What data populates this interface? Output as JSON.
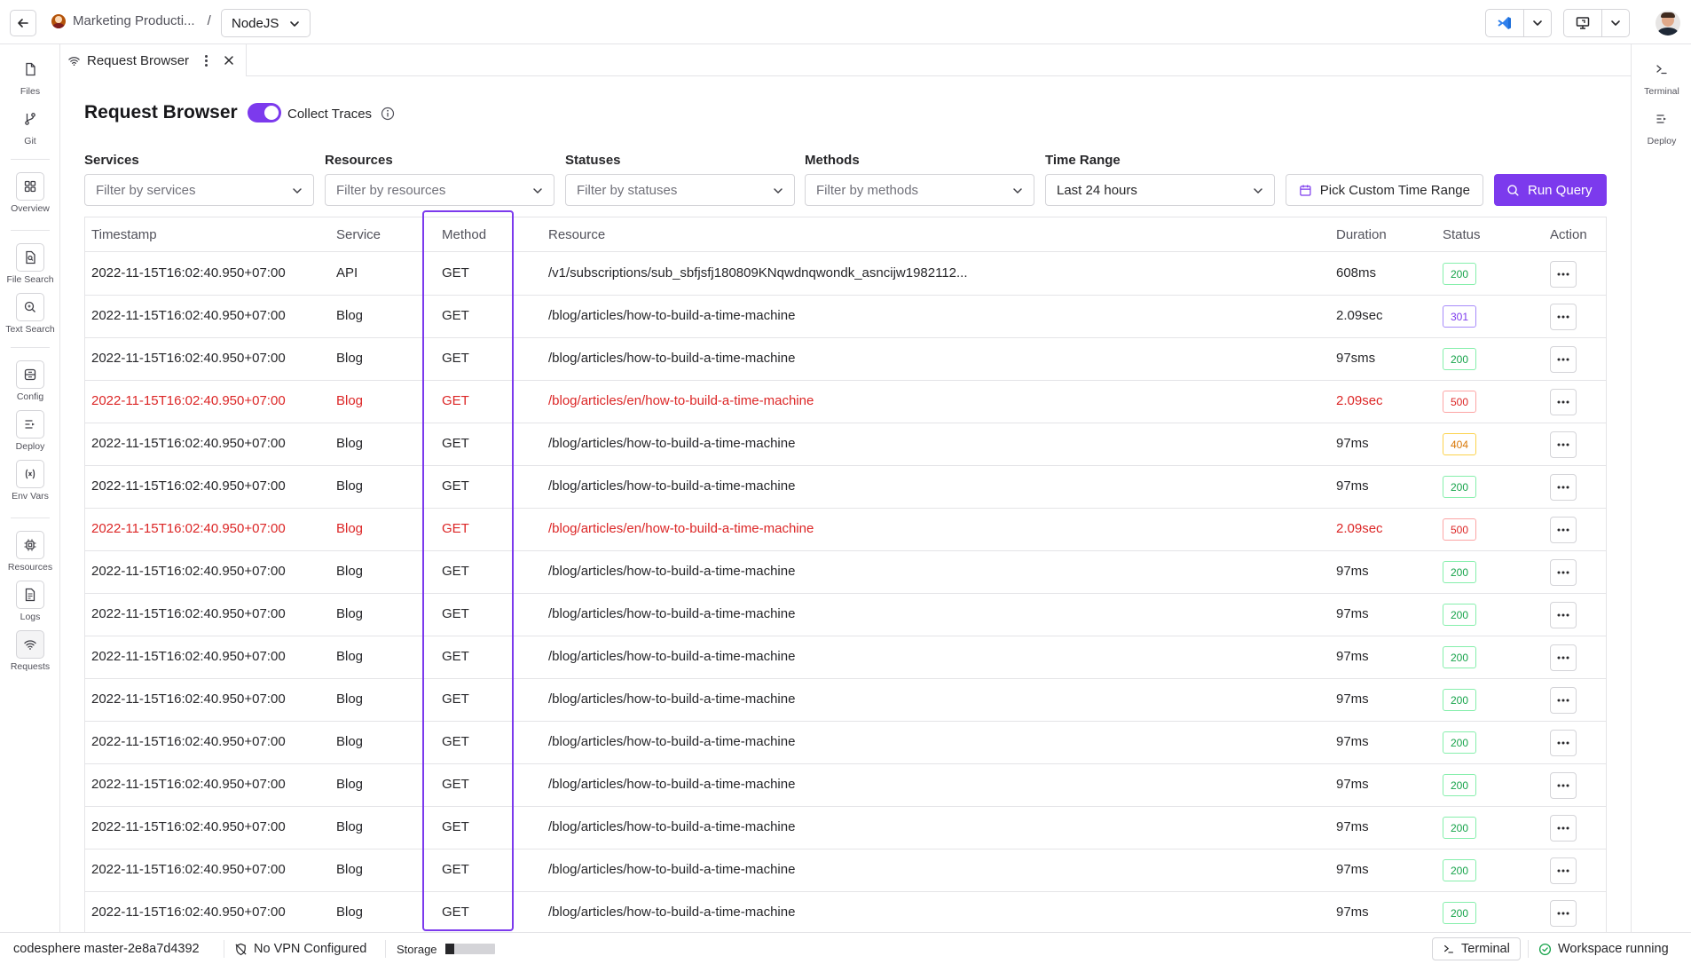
{
  "topbar": {
    "project_name": "Marketing Producti...",
    "separator": "/",
    "workspace_name": "NodeJS"
  },
  "left_rail": [
    {
      "label": "Files",
      "icon": "file-icon"
    },
    {
      "label": "Git",
      "icon": "git-branch-icon"
    },
    {
      "label": "Overview",
      "icon": "grid-icon"
    },
    {
      "label": "File Search",
      "icon": "file-search-icon"
    },
    {
      "label": "Text Search",
      "icon": "text-search-icon"
    },
    {
      "label": "Config",
      "icon": "config-icon"
    },
    {
      "label": "Deploy",
      "icon": "deploy-icon"
    },
    {
      "label": "Env Vars",
      "icon": "env-vars-icon"
    },
    {
      "label": "Resources",
      "icon": "chip-icon"
    },
    {
      "label": "Logs",
      "icon": "logs-icon"
    },
    {
      "label": "Requests",
      "icon": "wifi-icon"
    }
  ],
  "right_rail": [
    {
      "label": "Terminal",
      "icon": "terminal-icon"
    },
    {
      "label": "Deploy",
      "icon": "deploy-icon"
    }
  ],
  "tab": {
    "label": "Request Browser"
  },
  "header": {
    "title": "Request Browser",
    "toggle_label": "Collect Traces",
    "toggle_on": true
  },
  "filters": {
    "services": {
      "label": "Services",
      "placeholder": "Filter by services"
    },
    "resources": {
      "label": "Resources",
      "placeholder": "Filter by resources"
    },
    "statuses": {
      "label": "Statuses",
      "placeholder": "Filter by statuses"
    },
    "methods": {
      "label": "Methods",
      "placeholder": "Filter by methods"
    },
    "time_range": {
      "label": "Time Range",
      "value": "Last 24 hours"
    },
    "custom_range_button": "Pick Custom Time Range",
    "run_button": "Run Query"
  },
  "table": {
    "columns": [
      "Timestamp",
      "Service",
      "Method",
      "Resource",
      "Duration",
      "Status",
      "Action"
    ],
    "rows": [
      {
        "timestamp": "2022-11-15T16:02:40.950+07:00",
        "service": "API",
        "method": "GET",
        "resource": "/v1/subscriptions/sub_sbfjsfj180809KNqwdnqwondk_asncijw1982112...",
        "duration": "608ms",
        "status": "200",
        "error": false
      },
      {
        "timestamp": "2022-11-15T16:02:40.950+07:00",
        "service": "Blog",
        "method": "GET",
        "resource": "/blog/articles/how-to-build-a-time-machine",
        "duration": "2.09sec",
        "status": "301",
        "error": false
      },
      {
        "timestamp": "2022-11-15T16:02:40.950+07:00",
        "service": "Blog",
        "method": "GET",
        "resource": "/blog/articles/how-to-build-a-time-machine",
        "duration": "97sms",
        "status": "200",
        "error": false
      },
      {
        "timestamp": "2022-11-15T16:02:40.950+07:00",
        "service": "Blog",
        "method": "GET",
        "resource": "/blog/articles/en/how-to-build-a-time-machine",
        "duration": "2.09sec",
        "status": "500",
        "error": true
      },
      {
        "timestamp": "2022-11-15T16:02:40.950+07:00",
        "service": "Blog",
        "method": "GET",
        "resource": "/blog/articles/how-to-build-a-time-machine",
        "duration": "97ms",
        "status": "404",
        "error": false
      },
      {
        "timestamp": "2022-11-15T16:02:40.950+07:00",
        "service": "Blog",
        "method": "GET",
        "resource": "/blog/articles/how-to-build-a-time-machine",
        "duration": "97ms",
        "status": "200",
        "error": false
      },
      {
        "timestamp": "2022-11-15T16:02:40.950+07:00",
        "service": "Blog",
        "method": "GET",
        "resource": "/blog/articles/en/how-to-build-a-time-machine",
        "duration": "2.09sec",
        "status": "500",
        "error": true
      },
      {
        "timestamp": "2022-11-15T16:02:40.950+07:00",
        "service": "Blog",
        "method": "GET",
        "resource": "/blog/articles/how-to-build-a-time-machine",
        "duration": "97ms",
        "status": "200",
        "error": false
      },
      {
        "timestamp": "2022-11-15T16:02:40.950+07:00",
        "service": "Blog",
        "method": "GET",
        "resource": "/blog/articles/how-to-build-a-time-machine",
        "duration": "97ms",
        "status": "200",
        "error": false
      },
      {
        "timestamp": "2022-11-15T16:02:40.950+07:00",
        "service": "Blog",
        "method": "GET",
        "resource": "/blog/articles/how-to-build-a-time-machine",
        "duration": "97ms",
        "status": "200",
        "error": false
      },
      {
        "timestamp": "2022-11-15T16:02:40.950+07:00",
        "service": "Blog",
        "method": "GET",
        "resource": "/blog/articles/how-to-build-a-time-machine",
        "duration": "97ms",
        "status": "200",
        "error": false
      },
      {
        "timestamp": "2022-11-15T16:02:40.950+07:00",
        "service": "Blog",
        "method": "GET",
        "resource": "/blog/articles/how-to-build-a-time-machine",
        "duration": "97ms",
        "status": "200",
        "error": false
      },
      {
        "timestamp": "2022-11-15T16:02:40.950+07:00",
        "service": "Blog",
        "method": "GET",
        "resource": "/blog/articles/how-to-build-a-time-machine",
        "duration": "97ms",
        "status": "200",
        "error": false
      },
      {
        "timestamp": "2022-11-15T16:02:40.950+07:00",
        "service": "Blog",
        "method": "GET",
        "resource": "/blog/articles/how-to-build-a-time-machine",
        "duration": "97ms",
        "status": "200",
        "error": false
      },
      {
        "timestamp": "2022-11-15T16:02:40.950+07:00",
        "service": "Blog",
        "method": "GET",
        "resource": "/blog/articles/how-to-build-a-time-machine",
        "duration": "97ms",
        "status": "200",
        "error": false
      },
      {
        "timestamp": "2022-11-15T16:02:40.950+07:00",
        "service": "Blog",
        "method": "GET",
        "resource": "/blog/articles/how-to-build-a-time-machine",
        "duration": "97ms",
        "status": "200",
        "error": false
      }
    ]
  },
  "status_colors": {
    "200": {
      "fg": "#16a34a",
      "border": "#86efac"
    },
    "301": {
      "fg": "#7c3aed",
      "border": "#a78bfa"
    },
    "404": {
      "fg": "#d97706",
      "border": "#fcd34d"
    },
    "500": {
      "fg": "#dc2626",
      "border": "#fca5a5"
    }
  },
  "colors": {
    "accent": "#7c3aed",
    "error": "#dc2626",
    "border": "#e4e4e7"
  },
  "status_bar": {
    "branch": "codesphere master-2e8a7d4392",
    "vpn": "No VPN Configured",
    "storage_label": "Storage",
    "storage_used_fraction": 0.18,
    "terminal": "Terminal",
    "workspace_status": "Workspace running"
  }
}
